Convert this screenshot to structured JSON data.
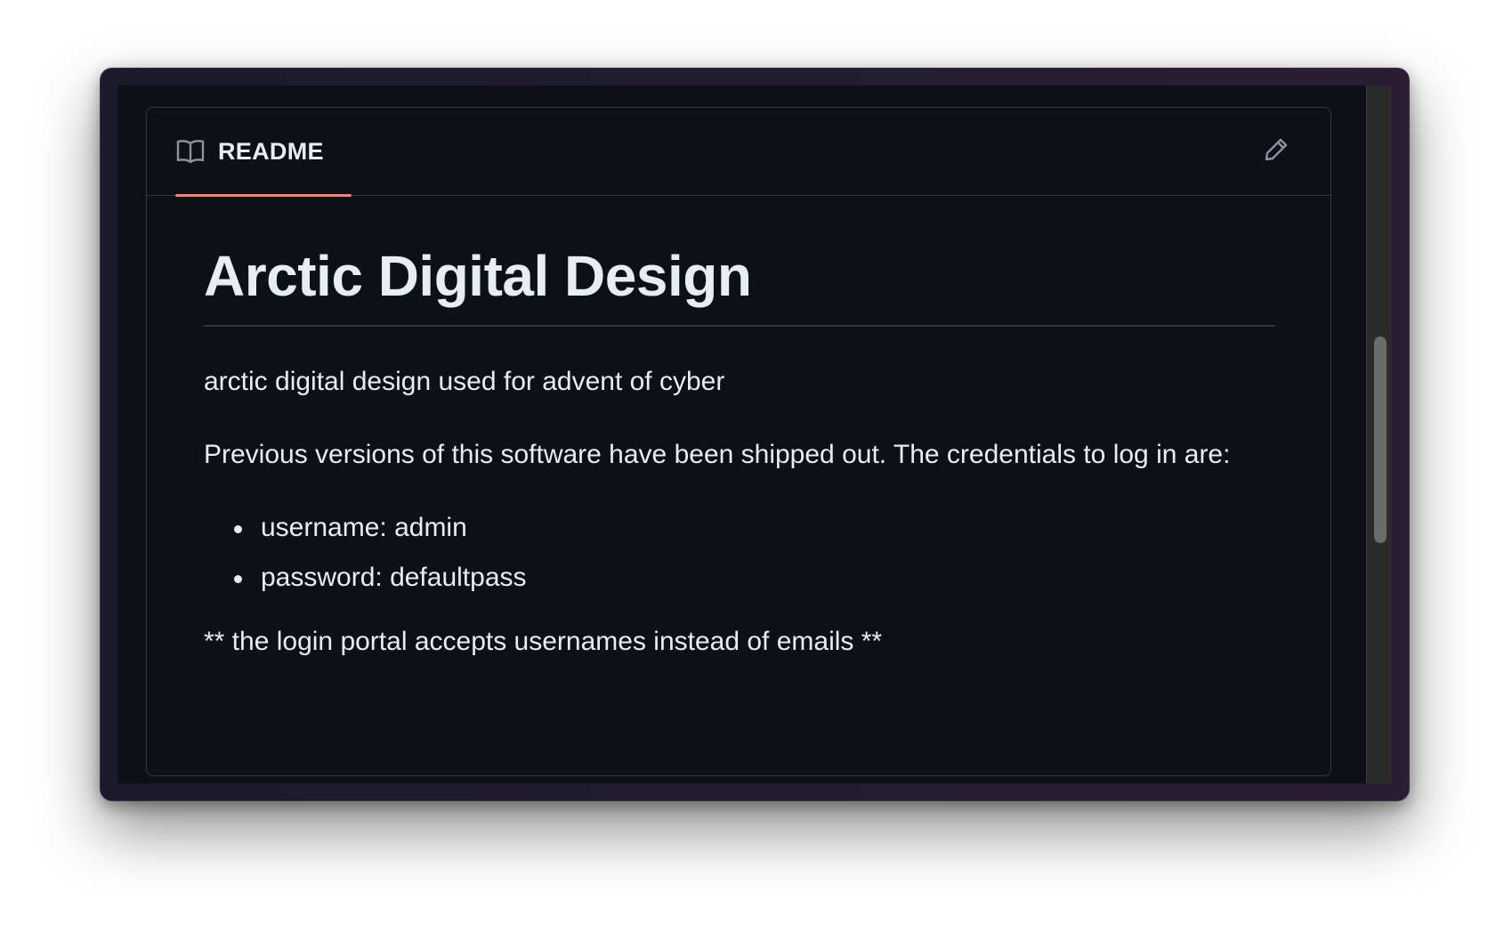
{
  "readme": {
    "tab_label": "README",
    "edit_icon": "pencil-icon",
    "tab_icon": "book-icon",
    "accent_color": "#f78166"
  },
  "content": {
    "title": "Arctic Digital Design",
    "description": "arctic digital design used for advent of cyber",
    "notice": "Previous versions of this software have been shipped out. The credentials to log in are:",
    "credentials": [
      "username: admin",
      "password: defaultpass"
    ],
    "footnote": "** the login portal accepts usernames instead of emails **"
  }
}
